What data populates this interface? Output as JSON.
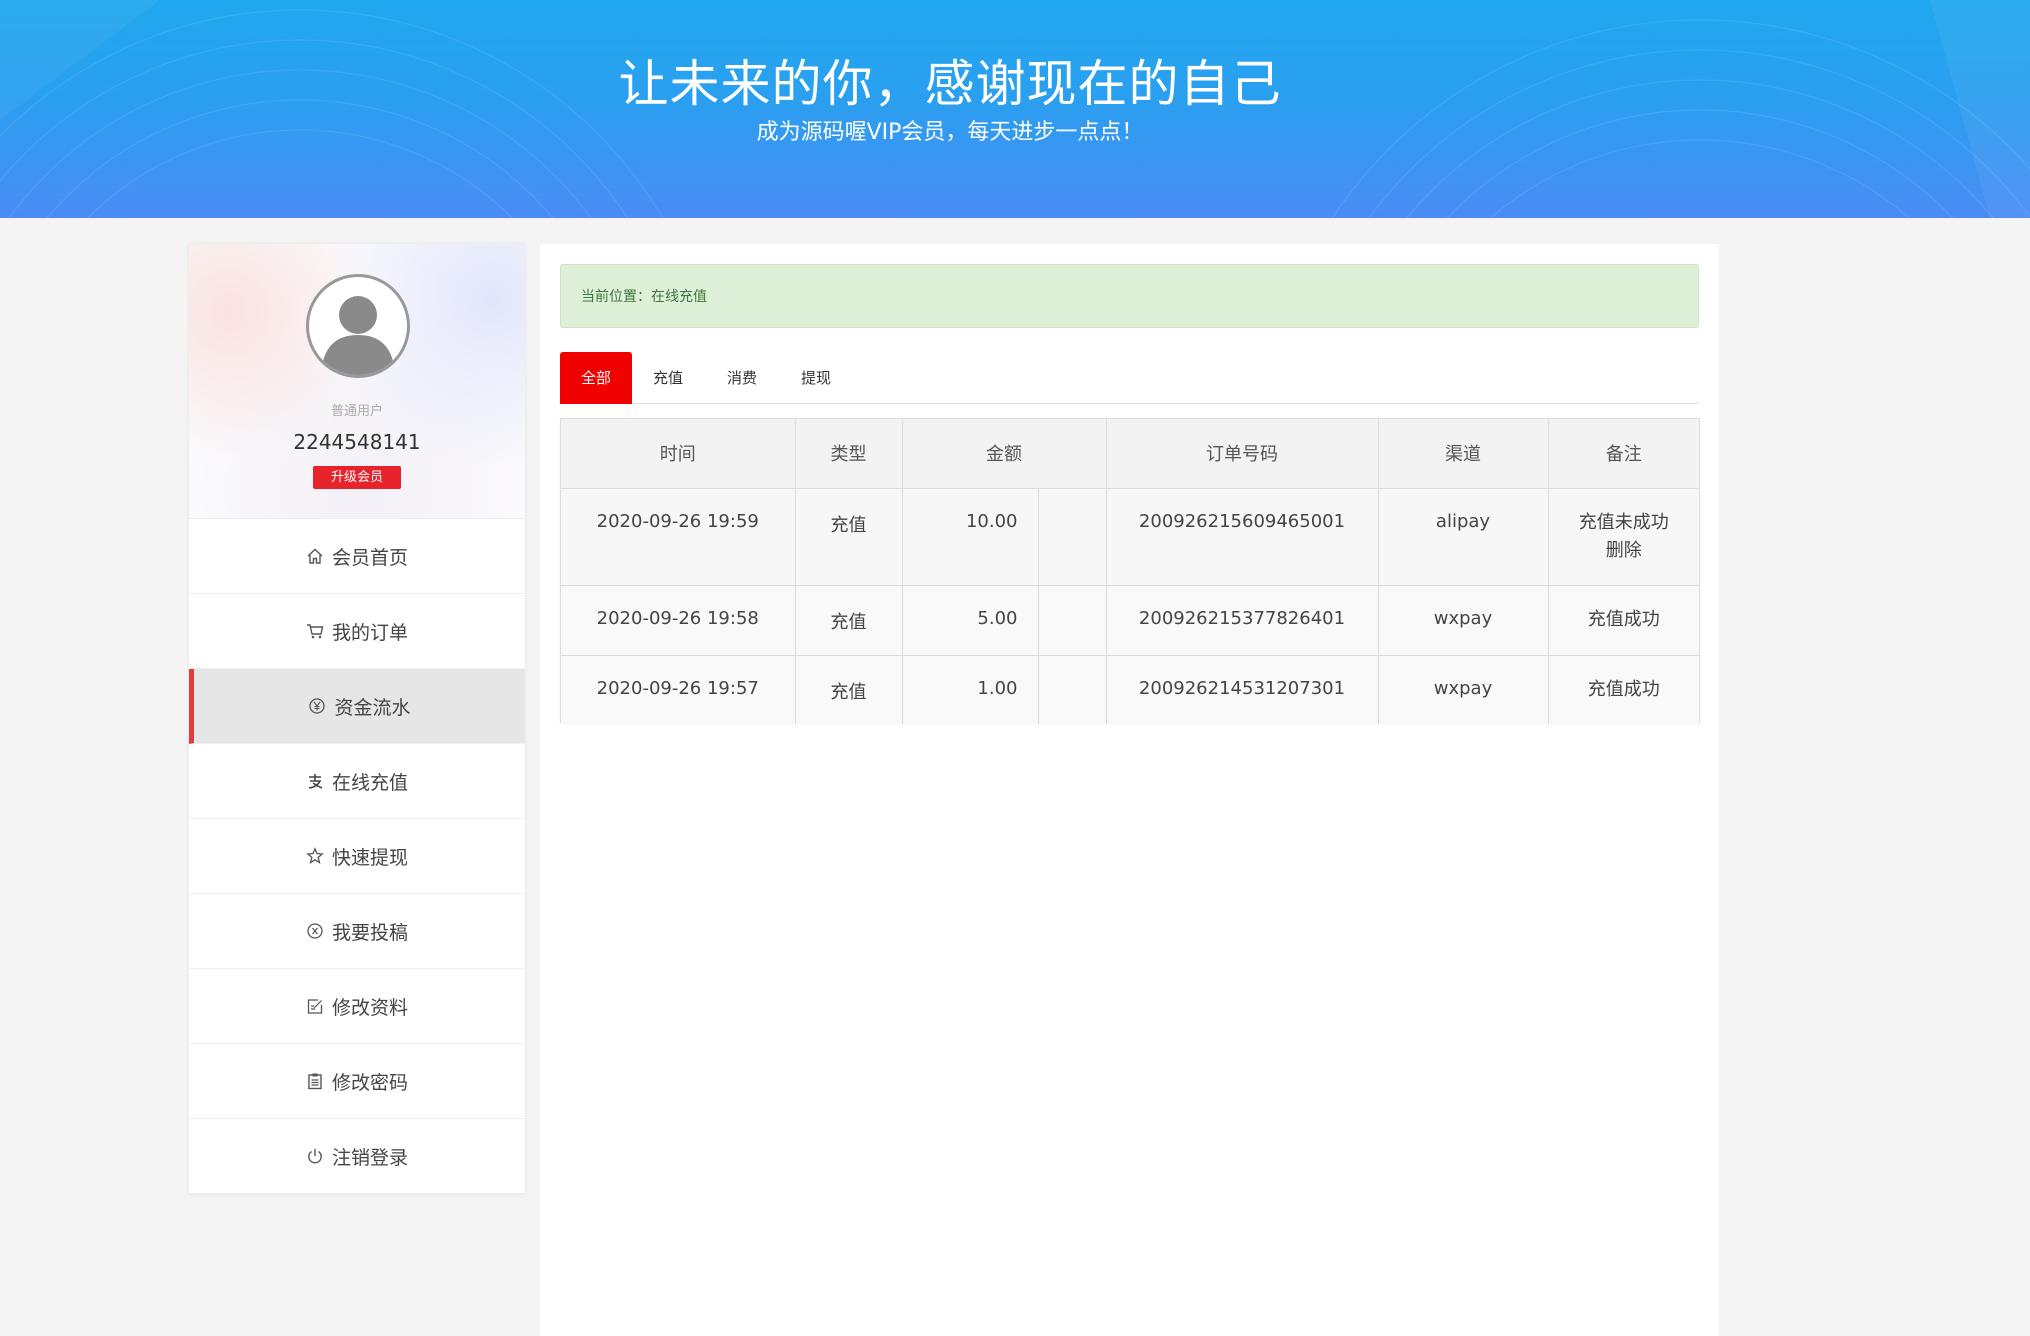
{
  "banner": {
    "title": "让未来的你，感谢现在的自己",
    "subtitle": "成为源码喔VIP会员，每天进步一点点！"
  },
  "profile": {
    "role": "普通用户",
    "user_id": "2244548141",
    "upgrade_label": "升级会员"
  },
  "menu": {
    "items": [
      {
        "label": "会员首页",
        "icon": "home-icon",
        "active": false
      },
      {
        "label": "我的订单",
        "icon": "cart-icon",
        "active": false
      },
      {
        "label": "资金流水",
        "icon": "yen-circle-icon",
        "active": true
      },
      {
        "label": "在线充值",
        "icon": "alipay-icon",
        "active": false
      },
      {
        "label": "快速提现",
        "icon": "star-icon",
        "active": false
      },
      {
        "label": "我要投稿",
        "icon": "coin-icon",
        "active": false
      },
      {
        "label": "修改资料",
        "icon": "edit-icon",
        "active": false
      },
      {
        "label": "修改密码",
        "icon": "clipboard-icon",
        "active": false
      },
      {
        "label": "注销登录",
        "icon": "power-icon",
        "active": false
      }
    ]
  },
  "breadcrumb": "当前位置：在线充值",
  "tabs": [
    {
      "label": "全部",
      "active": true
    },
    {
      "label": "充值",
      "active": false
    },
    {
      "label": "消费",
      "active": false
    },
    {
      "label": "提现",
      "active": false
    }
  ],
  "table": {
    "headers": [
      "时间",
      "类型",
      "金额",
      "订单号码",
      "渠道",
      "备注"
    ],
    "rows": [
      {
        "time": "2020-09-26 19:59",
        "type": "充值",
        "amount": "10.00",
        "order": "200926215609465001",
        "channel": "alipay",
        "note": "充值未成功",
        "action": "删除"
      },
      {
        "time": "2020-09-26 19:58",
        "type": "充值",
        "amount": "5.00",
        "order": "200926215377826401",
        "channel": "wxpay",
        "note": "充值成功",
        "action": ""
      },
      {
        "time": "2020-09-26 19:57",
        "type": "充值",
        "amount": "1.00",
        "order": "200926214531207301",
        "channel": "wxpay",
        "note": "充值成功",
        "action": ""
      }
    ]
  },
  "colors": {
    "accent_red": "#f10000",
    "active_border": "#e23b3b",
    "banner_blue": "#2a9ff0",
    "breadcrumb_bg": "#dff0d8"
  }
}
